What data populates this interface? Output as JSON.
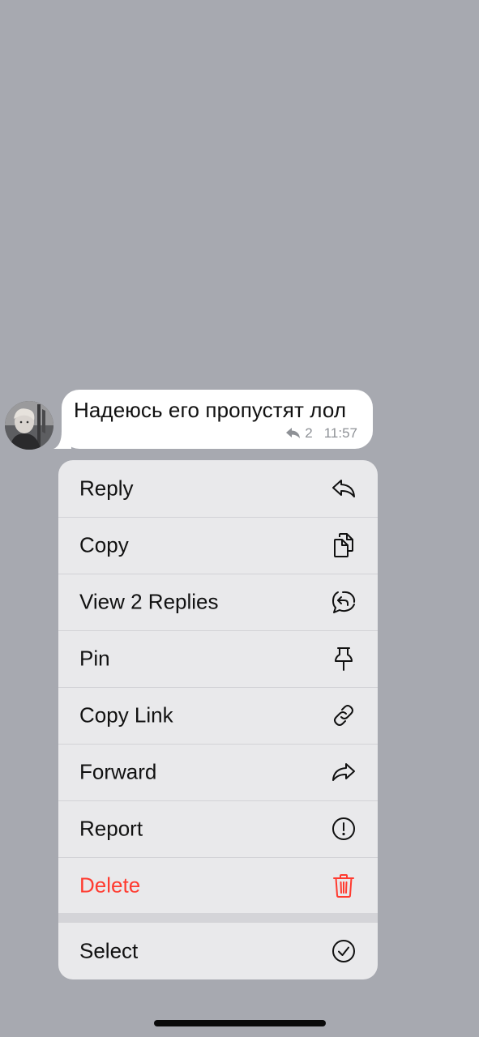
{
  "message": {
    "text": "Надеюсь его пропустят лол",
    "reply_count": "2",
    "time": "11:57",
    "reply_icon": "reply-arrow-icon"
  },
  "avatar": {
    "icon": "user-avatar-photo"
  },
  "menu": {
    "items": [
      {
        "label": "Reply",
        "icon": "reply-icon"
      },
      {
        "label": "Copy",
        "icon": "copy-icon"
      },
      {
        "label": "View 2 Replies",
        "icon": "replies-thread-icon"
      },
      {
        "label": "Pin",
        "icon": "pin-icon"
      },
      {
        "label": "Copy Link",
        "icon": "link-icon"
      },
      {
        "label": "Forward",
        "icon": "forward-icon"
      },
      {
        "label": "Report",
        "icon": "exclamation-circle-icon"
      },
      {
        "label": "Delete",
        "icon": "trash-icon"
      }
    ],
    "select": {
      "label": "Select",
      "icon": "checkmark-circle-icon"
    }
  },
  "colors": {
    "background": "#a7a9b0",
    "menu": "#e9e9eb",
    "danger": "#ff3b30",
    "bubble": "#ffffff",
    "meta": "#8e9196"
  }
}
